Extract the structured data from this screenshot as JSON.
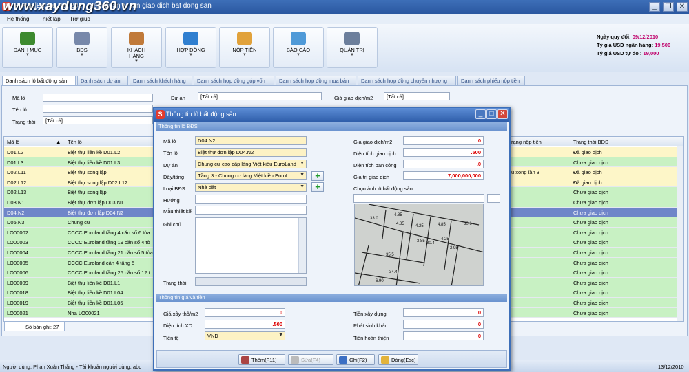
{
  "window": {
    "title": "SLRealEstate.Net 201... nem quan ly san giao dich bat dong san",
    "watermark": "www.xaydung360.vn"
  },
  "menu": [
    "Hệ thống",
    "Thiết lập",
    "Trợ giúp"
  ],
  "ribbon": [
    {
      "label": "DANH MỤC",
      "icon": "books-icon",
      "color": "#3d8a2f"
    },
    {
      "label": "BĐS",
      "icon": "building-icon",
      "color": "#7788aa"
    },
    {
      "label": "KHÁCH HÀNG",
      "icon": "users-icon",
      "color": "#c07a3a"
    },
    {
      "label": "HỢP ĐỒNG",
      "icon": "contract-icon",
      "color": "#2f7fd0"
    },
    {
      "label": "NỘP TIỀN",
      "icon": "payment-icon",
      "color": "#e1a23b"
    },
    {
      "label": "BÁO CÁO",
      "icon": "report-icon",
      "color": "#4f9ad8"
    },
    {
      "label": "QUẢN TRỊ",
      "icon": "computer-icon",
      "color": "#6c7f9c"
    }
  ],
  "info": {
    "date_label": "Ngày quy đổi:",
    "date": "09/12/2010",
    "bank_label": "Tỷ giá USD ngân hàng:",
    "bank": "19,500",
    "free_label": "Tỷ giá USD tự do :",
    "free": "19,000"
  },
  "tabs": [
    "Danh sách lô bất động sản",
    "Danh sách dự án",
    "Danh sách khách hàng",
    "Danh sách hợp đồng góp vốn",
    "Danh sách hợp đồng mua bán",
    "Danh sách hợp đồng chuyển nhượng",
    "Danh sách phiếu nộp tiền"
  ],
  "filters": {
    "ma_lo": "Mã lô",
    "ten_lo": "Tên lô",
    "trang_thai": "Trạng thái",
    "trang_thai_value": "[Tất cả]",
    "du_an": "Dự án",
    "du_an_value": "[Tất cả]",
    "gia_gd": "Giá giao dịch/m2",
    "gia_gd_value": "[Tất cả]"
  },
  "grid": {
    "headers": [
      "Mã lô",
      "Tên lô",
      "rạng nộp tiền",
      "Trạng thái BĐS"
    ],
    "rows": [
      {
        "ma": "D01.L2",
        "ten": "Biệt thự liền kề D01.L2",
        "nop": "",
        "tt": "Đã giao dịch",
        "color": "#fdf6c8"
      },
      {
        "ma": "D01.L3",
        "ten": "Biệt thự liền kề D01.L3",
        "nop": "",
        "tt": "Chưa giao dịch",
        "color": "#c8f1c3"
      },
      {
        "ma": "D02.L11",
        "ten": "Biệt thự song lập",
        "nop": "u xong lần 3",
        "tt": "Đã giao dịch",
        "color": "#fdf6c8"
      },
      {
        "ma": "D02.L12",
        "ten": "Biệt thự song lập D02.L12",
        "nop": "",
        "tt": "Đã giao dịch",
        "color": "#fdf6c8"
      },
      {
        "ma": "D02.L13",
        "ten": "Biệt thự song lập",
        "nop": "",
        "tt": "Chưa giao dịch",
        "color": "#c8f1c3"
      },
      {
        "ma": "D03.N1",
        "ten": "Biệt thự đơn lập D03.N1",
        "nop": "",
        "tt": "Chưa giao dịch",
        "color": "#c8f1c3"
      },
      {
        "ma": "D04.N2",
        "ten": "Biệt thự đơn lập D04.N2",
        "nop": "",
        "tt": "Chưa giao dịch",
        "color": "#6f86c9"
      },
      {
        "ma": "D05.N3",
        "ten": "Chung cư",
        "nop": "",
        "tt": "Chưa giao dịch",
        "color": "#c8f1c3"
      },
      {
        "ma": "LO00002",
        "ten": "CCCC Euroland tầng 4 căn số 6 tòa",
        "nop": "",
        "tt": "Chưa giao dịch",
        "color": "#c8f1c3"
      },
      {
        "ma": "LO00003",
        "ten": "CCCC Euroland tầng 19 căn số 4 tò",
        "nop": "",
        "tt": "Chưa giao dịch",
        "color": "#c8f1c3"
      },
      {
        "ma": "LO00004",
        "ten": "CCCC Euroland tầng 21 căn số 5 tòa",
        "nop": "",
        "tt": "Chưa giao dịch",
        "color": "#c8f1c3"
      },
      {
        "ma": "LO00005",
        "ten": "CCCC Euroland căn 4 tầng 5",
        "nop": "",
        "tt": "Chưa giao dịch",
        "color": "#c8f1c3"
      },
      {
        "ma": "LO00006",
        "ten": "CCCC Euroland tầng 25 căn số 12 t",
        "nop": "",
        "tt": "Chưa giao dịch",
        "color": "#c8f1c3"
      },
      {
        "ma": "LO00009",
        "ten": "Biệt thự liền kề D01.L1",
        "nop": "",
        "tt": "Chưa giao dịch",
        "color": "#c8f1c3"
      },
      {
        "ma": "LO00018",
        "ten": "Biệt thự liền kề D01.L04",
        "nop": "",
        "tt": "Chưa giao dịch",
        "color": "#c8f1c3"
      },
      {
        "ma": "LO00019",
        "ten": "Biệt thự liền kề D01.L05",
        "nop": "",
        "tt": "Chưa giao dịch",
        "color": "#c8f1c3"
      },
      {
        "ma": "LO00021",
        "ten": "Nha LO00021",
        "nop": "",
        "tt": "Chưa giao dịch",
        "color": "#c8f1c3"
      }
    ],
    "record_count": "Số bản ghi: 27"
  },
  "status": {
    "user": "Người dùng: Phan Xuân Thắng - Tài khoản người dùng: abc",
    "date": "13/12/2010"
  },
  "dialog": {
    "title": "Thông tin lô bất động sản",
    "section1": "Thông tin lô BĐS",
    "section2": "Thông tin giá và tiền",
    "ma_lo_label": "Mã lô",
    "ma_lo": "D04.N2",
    "ten_lo_label": "Tên lô",
    "ten_lo": "Biệt thự đơn lập D04.N2",
    "du_an_label": "Dự án",
    "du_an": "Chung cư cao cấp làng Việt kiều EuroLand",
    "day_tang_label": "Dãy/tầng",
    "day_tang": "Tầng 3 - Chung cư làng Việt kiều EuroL...",
    "loai_bds_label": "Loại BĐS",
    "loai_bds": "Nhà đất",
    "huong_label": "Hướng",
    "mau_tk_label": "Mẫu thiết kế",
    "ghi_chu_label": "Ghi chú",
    "trang_thai_label": "Trạng thái",
    "gia_gd_label": "Giá giao dịch/m2",
    "gia_gd": "0",
    "dt_gd_label": "Diện tích giao dịch",
    "dt_gd": ".500",
    "dt_bc_label": "Diện tích ban công",
    "dt_bc": ".0",
    "gia_tri_label": "Giá trị giao dịch",
    "gia_tri": "7,000,000,000",
    "chon_anh_label": "Chọn ảnh lô bất động sản",
    "browse": "....",
    "gia_xd_label": "Giá xây thô/m2",
    "gia_xd": "0",
    "dt_xd_label": "Diện tích XD",
    "dt_xd": ".500",
    "tien_te_label": "Tiền tệ",
    "tien_te": "VND",
    "tien_xd_label": "Tiền xây dựng",
    "tien_xd": "0",
    "phat_sinh_label": "Phát sinh khác",
    "phat_sinh": "0",
    "hoan_thien_label": "Tiền hoàn thiện",
    "hoan_thien": "0",
    "buttons": {
      "add": "Thêm(F11)",
      "edit": "Sửa(F4)",
      "save": "Ghi(F2)",
      "close": "Đóng(Esc)"
    },
    "map_labels": [
      "33.0",
      "4.85",
      "4.25",
      "4.85",
      "30.6",
      "35.5",
      "30.4",
      "34.4",
      "3.85",
      "2.95",
      "4.25",
      "6.90",
      "4.85"
    ]
  }
}
